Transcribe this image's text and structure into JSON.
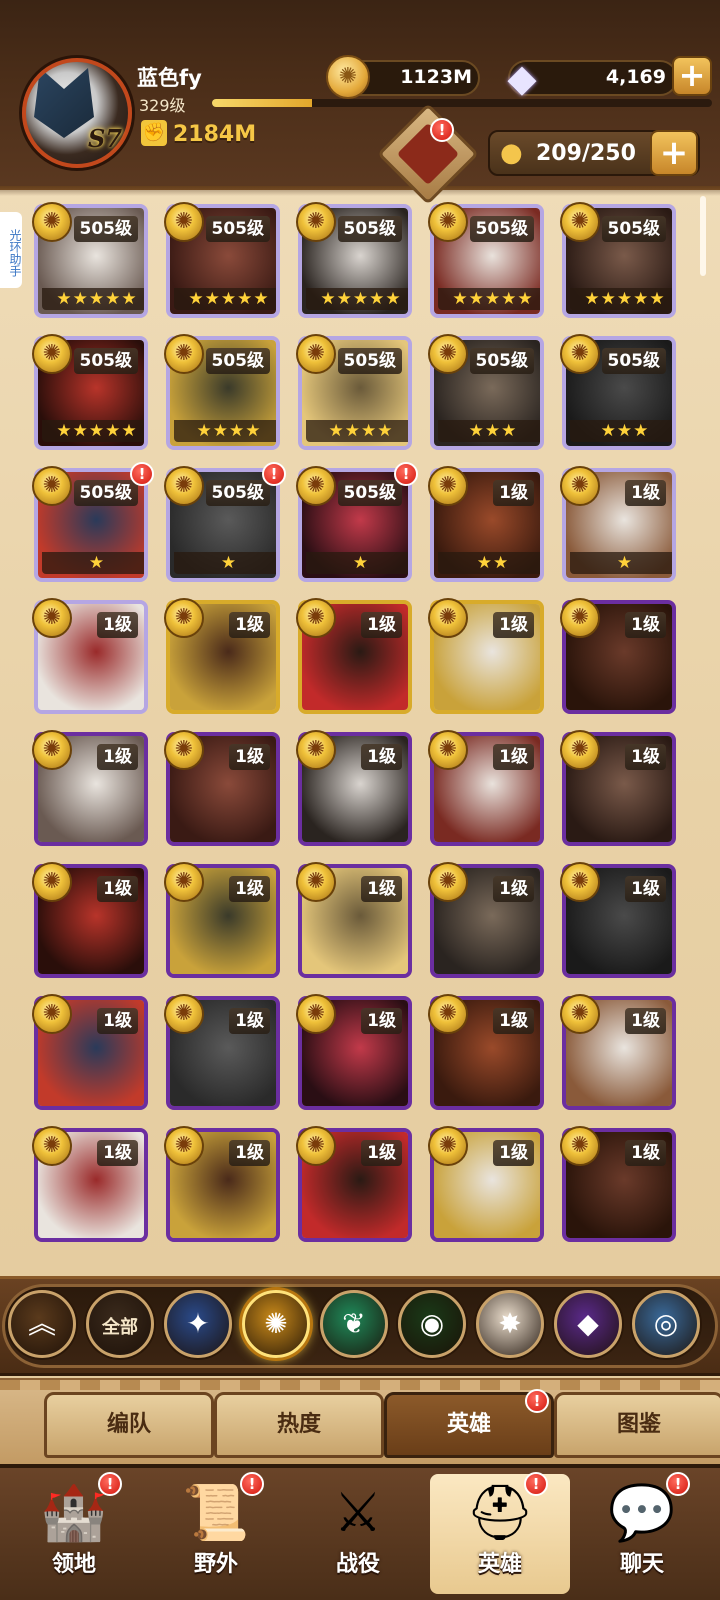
{
  "header": {
    "player_name": "蓝色fy",
    "player_level": "329级",
    "exp_progress": 0.2,
    "season_badge": "S7",
    "power": "2184M",
    "gold": "1123M",
    "gems": "4,169",
    "hero_capacity": "209/250",
    "side_tab": "光环助手"
  },
  "heroes": [
    {
      "level": "505级",
      "stars": "★★★★★",
      "alert": false,
      "frame": "white"
    },
    {
      "level": "505级",
      "stars": "★★★★★",
      "alert": false,
      "frame": "white"
    },
    {
      "level": "505级",
      "stars": "★★★★★",
      "alert": false,
      "frame": "white"
    },
    {
      "level": "505级",
      "stars": "★★★★★",
      "alert": false,
      "frame": "white"
    },
    {
      "level": "505级",
      "stars": "★★★★★",
      "alert": false,
      "frame": "white"
    },
    {
      "level": "505级",
      "stars": "★★★★★",
      "alert": false,
      "frame": "white"
    },
    {
      "level": "505级",
      "stars": "★★★★",
      "alert": false,
      "frame": "white"
    },
    {
      "level": "505级",
      "stars": "★★★★",
      "alert": false,
      "frame": "white"
    },
    {
      "level": "505级",
      "stars": "★★★",
      "alert": false,
      "frame": "white"
    },
    {
      "level": "505级",
      "stars": "★★★",
      "alert": false,
      "frame": "white"
    },
    {
      "level": "505级",
      "stars": "★",
      "alert": true,
      "frame": "white"
    },
    {
      "level": "505级",
      "stars": "★",
      "alert": true,
      "frame": "white"
    },
    {
      "level": "505级",
      "stars": "★",
      "alert": true,
      "frame": "white"
    },
    {
      "level": "1级",
      "stars": "★★",
      "alert": false,
      "frame": "white"
    },
    {
      "level": "1级",
      "stars": "★",
      "alert": false,
      "frame": "white"
    },
    {
      "level": "1级",
      "stars": "",
      "alert": false,
      "frame": "white"
    },
    {
      "level": "1级",
      "stars": "",
      "alert": false,
      "frame": "gold"
    },
    {
      "level": "1级",
      "stars": "",
      "alert": false,
      "frame": "gold"
    },
    {
      "level": "1级",
      "stars": "",
      "alert": false,
      "frame": "gold"
    },
    {
      "level": "1级",
      "stars": "",
      "alert": false,
      "frame": "purple"
    },
    {
      "level": "1级",
      "stars": "",
      "alert": false,
      "frame": "purple"
    },
    {
      "level": "1级",
      "stars": "",
      "alert": false,
      "frame": "purple"
    },
    {
      "level": "1级",
      "stars": "",
      "alert": false,
      "frame": "purple"
    },
    {
      "level": "1级",
      "stars": "",
      "alert": false,
      "frame": "purple"
    },
    {
      "level": "1级",
      "stars": "",
      "alert": false,
      "frame": "purple"
    },
    {
      "level": "1级",
      "stars": "",
      "alert": false,
      "frame": "purple"
    },
    {
      "level": "1级",
      "stars": "",
      "alert": false,
      "frame": "purple"
    },
    {
      "level": "1级",
      "stars": "",
      "alert": false,
      "frame": "purple"
    },
    {
      "level": "1级",
      "stars": "",
      "alert": false,
      "frame": "purple"
    },
    {
      "level": "1级",
      "stars": "",
      "alert": false,
      "frame": "purple"
    },
    {
      "level": "1级",
      "stars": "",
      "alert": false,
      "frame": "purple"
    },
    {
      "level": "1级",
      "stars": "",
      "alert": false,
      "frame": "purple"
    },
    {
      "level": "1级",
      "stars": "",
      "alert": false,
      "frame": "purple"
    },
    {
      "level": "1级",
      "stars": "",
      "alert": false,
      "frame": "purple"
    },
    {
      "level": "1级",
      "stars": "",
      "alert": false,
      "frame": "purple"
    },
    {
      "level": "1级",
      "stars": "",
      "alert": false,
      "frame": "purple"
    },
    {
      "level": "1级",
      "stars": "",
      "alert": false,
      "frame": "purple"
    },
    {
      "level": "1级",
      "stars": "",
      "alert": false,
      "frame": "purple"
    },
    {
      "level": "1级",
      "stars": "",
      "alert": false,
      "frame": "purple"
    },
    {
      "level": "1级",
      "stars": "",
      "alert": false,
      "frame": "purple"
    }
  ],
  "filters": [
    {
      "icon": "up-chevron-icon",
      "label": "",
      "glyph": "︽",
      "color": "#5a3a1c",
      "active": false
    },
    {
      "icon": "all-filter",
      "label": "全部",
      "glyph": "",
      "color": "#3a2a1c",
      "active": false
    },
    {
      "icon": "lightbearer-icon",
      "label": "",
      "glyph": "✦",
      "color": "#2a4a8a",
      "active": false
    },
    {
      "icon": "mauler-icon",
      "label": "",
      "glyph": "✺",
      "color": "#c98a1a",
      "active": true
    },
    {
      "icon": "wilder-icon",
      "label": "",
      "glyph": "❦",
      "color": "#1f8a5a",
      "active": false
    },
    {
      "icon": "graveborn-icon",
      "label": "",
      "glyph": "◉",
      "color": "#1a3a18",
      "active": false
    },
    {
      "icon": "celestial-icon",
      "label": "",
      "glyph": "✸",
      "color": "#e9dccb",
      "active": false
    },
    {
      "icon": "hypogean-icon",
      "label": "",
      "glyph": "◆",
      "color": "#5a2a8a",
      "active": false
    },
    {
      "icon": "dimensional-icon",
      "label": "",
      "glyph": "◎",
      "color": "#3a6a9a",
      "active": false
    }
  ],
  "sub_tabs": [
    {
      "label": "编队",
      "active": false,
      "alert": false
    },
    {
      "label": "热度",
      "active": false,
      "alert": false
    },
    {
      "label": "英雄",
      "active": true,
      "alert": true
    },
    {
      "label": "图鉴",
      "active": false,
      "alert": false
    }
  ],
  "bottom_nav": [
    {
      "label": "领地",
      "icon": "castle-icon",
      "glyph": "🏰",
      "alert": true,
      "active": false
    },
    {
      "label": "野外",
      "icon": "scroll-map-icon",
      "glyph": "📜",
      "alert": true,
      "active": false
    },
    {
      "label": "战役",
      "icon": "crossed-swords-icon",
      "glyph": "⚔",
      "alert": false,
      "active": false
    },
    {
      "label": "英雄",
      "icon": "helmet-icon",
      "glyph": "⛑",
      "alert": true,
      "active": true
    },
    {
      "label": "聊天",
      "icon": "chat-bubble-icon",
      "glyph": "💬",
      "alert": true,
      "active": false
    }
  ],
  "colors": {
    "accent_gold": "#f6c746",
    "alert_red": "#d3160c",
    "wood_dark": "#4a2e18"
  }
}
